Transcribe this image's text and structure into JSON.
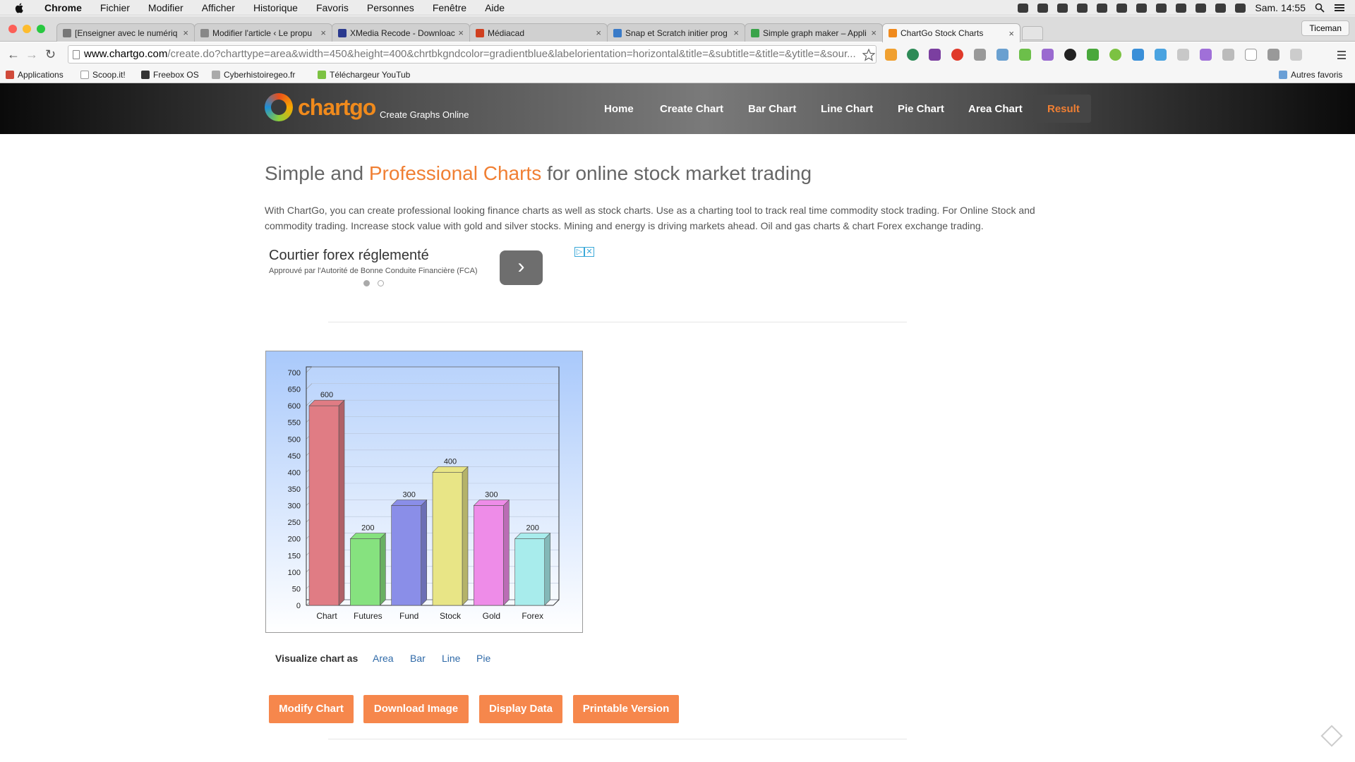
{
  "menubar": {
    "items": [
      "Chrome",
      "Fichier",
      "Modifier",
      "Afficher",
      "Historique",
      "Favoris",
      "Personnes",
      "Fenêtre",
      "Aide"
    ],
    "clock": "Sam. 14:55"
  },
  "tabs": [
    {
      "label": "[Enseigner avec le numériq",
      "color": "#777777"
    },
    {
      "label": "Modifier l'article ‹ Le propu",
      "color": "#888888"
    },
    {
      "label": "XMedia Recode - Downloac",
      "color": "#2b3a8f"
    },
    {
      "label": "Médiacad",
      "color": "#d04020"
    },
    {
      "label": "Snap et Scratch initier prog",
      "color": "#3a7bc8"
    },
    {
      "label": "Simple graph maker – Appli",
      "color": "#3aa34a"
    },
    {
      "label": "ChartGo Stock Charts",
      "color": "#f08a1c"
    }
  ],
  "profile": "Ticeman",
  "address": {
    "host": "www.chartgo.com",
    "path": "/create.do?charttype=area&width=450&height=400&chrtbkgndcolor=gradientblue&labelorientation=horizontal&title=&subtitle=&title=&ytitle=&sour..."
  },
  "bookmarks": [
    "Applications",
    "Scoop.it!",
    "Freebox OS",
    "Cyberhistoiregeo.fr",
    "Téléchargeur YouTub"
  ],
  "bookmarks_right": "Autres favoris",
  "site": {
    "logo": "chartgo",
    "tagline": "Create Graphs Online",
    "nav": [
      "Home",
      "Create Chart",
      "Bar Chart",
      "Line Chart",
      "Pie Chart",
      "Area Chart",
      "Result"
    ],
    "accent": "#f07f33"
  },
  "content": {
    "headline_pre": "Simple and ",
    "headline_highlight": "Professional Charts",
    "headline_post": " for online stock market trading",
    "intro": "With ChartGo, you can create professional looking finance charts as well as stock charts. Use as a charting tool to track real time commodity stock trading. For Online Stock and commodity trading. Increase stock value with gold and silver stocks. Mining and energy is driving markets ahead. Oil and gas charts & chart Forex exchange trading."
  },
  "ad": {
    "title": "Courtier forex réglementé",
    "subtitle": "Approuvé par l'Autorité de Bonne Conduite Financière (FCA)"
  },
  "chart_data": {
    "type": "bar",
    "categories": [
      "Chart",
      "Futures",
      "Fund",
      "Stock",
      "Gold",
      "Forex"
    ],
    "values": [
      600,
      200,
      300,
      400,
      300,
      200
    ],
    "title": "",
    "xlabel": "",
    "ylabel": "",
    "ylim": [
      0,
      700
    ],
    "ytick_step": 50,
    "grid": true,
    "background": "gradient blue",
    "colors": [
      "#e07c84",
      "#86e27f",
      "#8a8ee8",
      "#e8e586",
      "#ee8ce8",
      "#a8ecec"
    ]
  },
  "visualize": {
    "label": "Visualize chart as",
    "options": [
      "Area",
      "Bar",
      "Line",
      "Pie"
    ]
  },
  "buttons": [
    "Modify Chart",
    "Download Image",
    "Display Data",
    "Printable Version"
  ]
}
